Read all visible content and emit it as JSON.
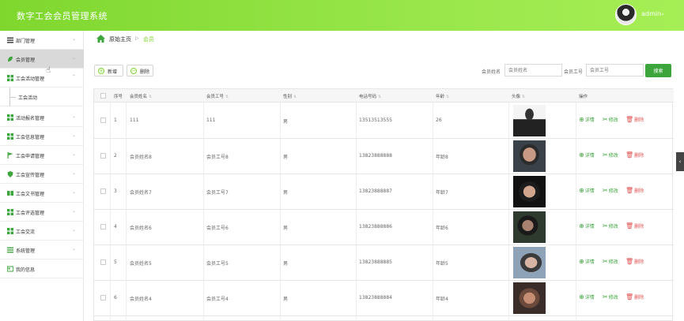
{
  "header": {
    "title": "数字工会会员管理系统",
    "user": "admin",
    "caret": "⌄"
  },
  "sidebar": {
    "items": [
      {
        "label": "部门管理",
        "icon": "list-icon",
        "active": false
      },
      {
        "label": "会员管理",
        "icon": "leaf-icon",
        "active": true
      },
      {
        "label": "工会活动管理",
        "icon": "grid-icon",
        "active": false,
        "expanded": true
      },
      {
        "label": "活动报名管理",
        "icon": "grid-icon",
        "active": false
      },
      {
        "label": "工会信息管理",
        "icon": "grid-icon",
        "active": false
      },
      {
        "label": "工会申请管理",
        "icon": "flag-icon",
        "active": false
      },
      {
        "label": "工会宣传管理",
        "icon": "shield-icon",
        "active": false
      },
      {
        "label": "工会文书管理",
        "icon": "book-icon",
        "active": false
      },
      {
        "label": "工会评选管理",
        "icon": "grid-icon",
        "active": false
      },
      {
        "label": "工会交流",
        "icon": "grid-icon",
        "active": false
      },
      {
        "label": "系统管理",
        "icon": "list-icon",
        "active": false
      },
      {
        "label": "我的信息",
        "icon": "card-icon",
        "active": false
      }
    ],
    "subitem": {
      "label": "工会活动"
    }
  },
  "breadcrumb": {
    "home": "原始主页",
    "sep": "▷",
    "current": "会员"
  },
  "toolbar": {
    "add": "新增",
    "delete": "删除"
  },
  "search": {
    "name_label": "会员姓名",
    "name_placeholder": "会员姓名",
    "id_label": "会员工号",
    "id_placeholder": "会员工号",
    "button": "搜索"
  },
  "table": {
    "headers": [
      "序号",
      "会员姓名",
      "会员工号",
      "性别",
      "电话号码",
      "年龄",
      "头像",
      "操作"
    ],
    "rows": [
      {
        "no": "1",
        "name": "111",
        "id": "111",
        "gender": "男",
        "phone": "13513513555",
        "age": "26"
      },
      {
        "no": "2",
        "name": "会员姓名8",
        "id": "会员工号8",
        "gender": "男",
        "phone": "13823888888",
        "age": "年龄8"
      },
      {
        "no": "3",
        "name": "会员姓名7",
        "id": "会员工号7",
        "gender": "男",
        "phone": "13823888887",
        "age": "年龄7"
      },
      {
        "no": "4",
        "name": "会员姓名6",
        "id": "会员工号6",
        "gender": "男",
        "phone": "13823888886",
        "age": "年龄6"
      },
      {
        "no": "5",
        "name": "会员姓名5",
        "id": "会员工号5",
        "gender": "男",
        "phone": "13823888885",
        "age": "年龄5"
      },
      {
        "no": "6",
        "name": "会员姓名4",
        "id": "会员工号4",
        "gender": "男",
        "phone": "13823888884",
        "age": "年龄4"
      }
    ],
    "ops": {
      "detail": "详情",
      "edit": "修改",
      "delete": "删除"
    }
  },
  "colors": {
    "accent": "#7fd72e",
    "search_button": "#3ca53c",
    "delete": "#e05050"
  }
}
